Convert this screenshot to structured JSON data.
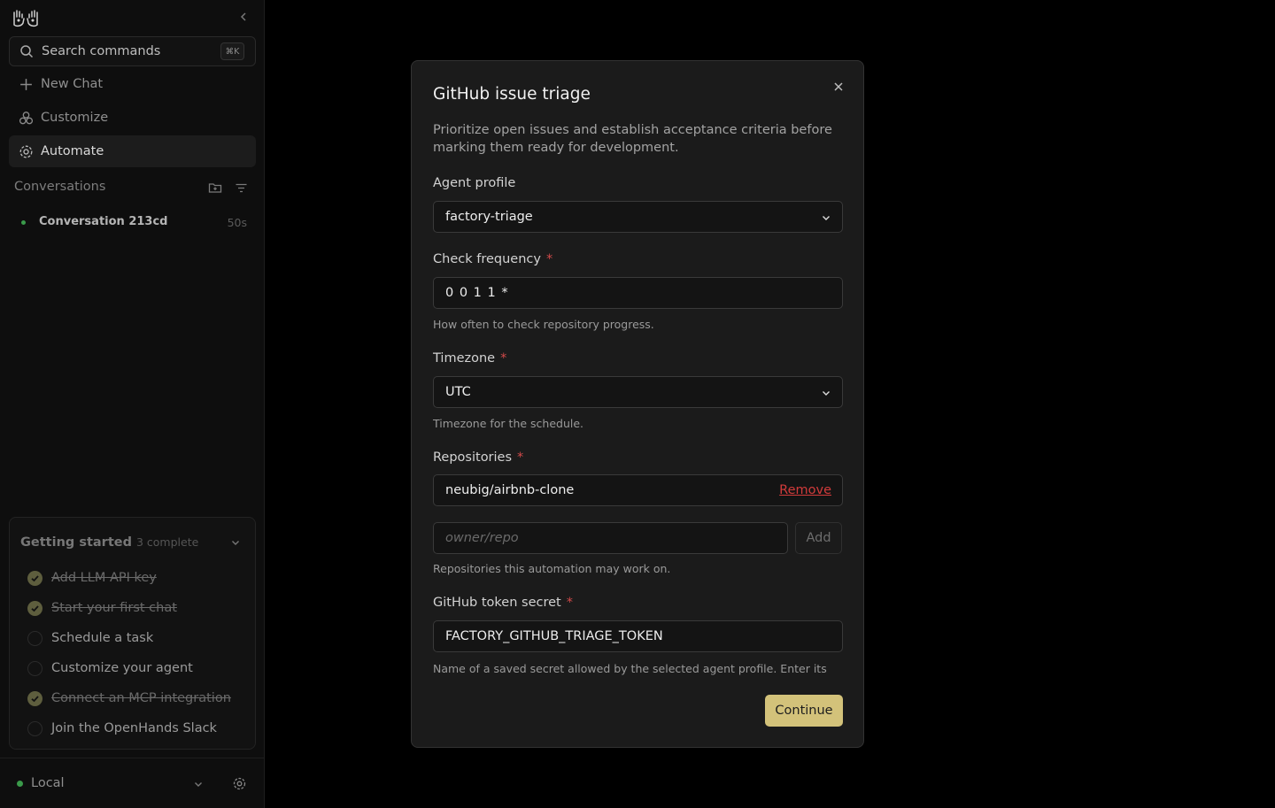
{
  "sidebar": {
    "search": {
      "label": "Search commands",
      "shortcut": "⌘K"
    },
    "nav": {
      "new_chat": "New Chat",
      "customize": "Customize",
      "automate": "Automate"
    },
    "conversations": {
      "header": "Conversations",
      "items": [
        {
          "title": "Conversation 213cd",
          "age": "50s",
          "status_color": "#3a9a4a"
        }
      ]
    },
    "getting_started": {
      "title": "Getting started",
      "count": "3 complete",
      "tasks": [
        {
          "label": "Add LLM API key",
          "done": true
        },
        {
          "label": "Start your first chat",
          "done": true
        },
        {
          "label": "Schedule a task",
          "done": false
        },
        {
          "label": "Customize your agent",
          "done": false
        },
        {
          "label": "Connect an MCP integration",
          "done": true
        },
        {
          "label": "Join the OpenHands Slack",
          "done": false
        }
      ]
    },
    "footer": {
      "label": "Local",
      "status_color": "#3a9a4a"
    }
  },
  "modal": {
    "title": "GitHub issue triage",
    "description": "Prioritize open issues and establish acceptance criteria before marking them ready for development.",
    "agent_profile": {
      "label": "Agent profile",
      "value": "factory-triage"
    },
    "check_frequency": {
      "label": "Check frequency",
      "required_mark": "*",
      "value": "0 0 1 1 *",
      "hint": "How often to check repository progress."
    },
    "timezone": {
      "label": "Timezone",
      "required_mark": "*",
      "value": "UTC",
      "hint": "Timezone for the schedule."
    },
    "repositories": {
      "label": "Repositories",
      "required_mark": "*",
      "items": [
        {
          "name": "neubig/airbnb-clone",
          "remove_label": "Remove"
        }
      ],
      "input_placeholder": "owner/repo",
      "add_label": "Add",
      "hint": "Repositories this automation may work on."
    },
    "token": {
      "label": "GitHub token secret",
      "required_mark": "*",
      "value": "FACTORY_GITHUB_TRIAGE_TOKEN",
      "hint": "Name of a saved secret allowed by the selected agent profile. Enter its name exactly."
    },
    "continue_label": "Continue"
  },
  "colors": {
    "accent": "#d3c27a",
    "required": "#d24a4a",
    "remove": "#d23b3b",
    "status_online": "#3a9a4a"
  }
}
